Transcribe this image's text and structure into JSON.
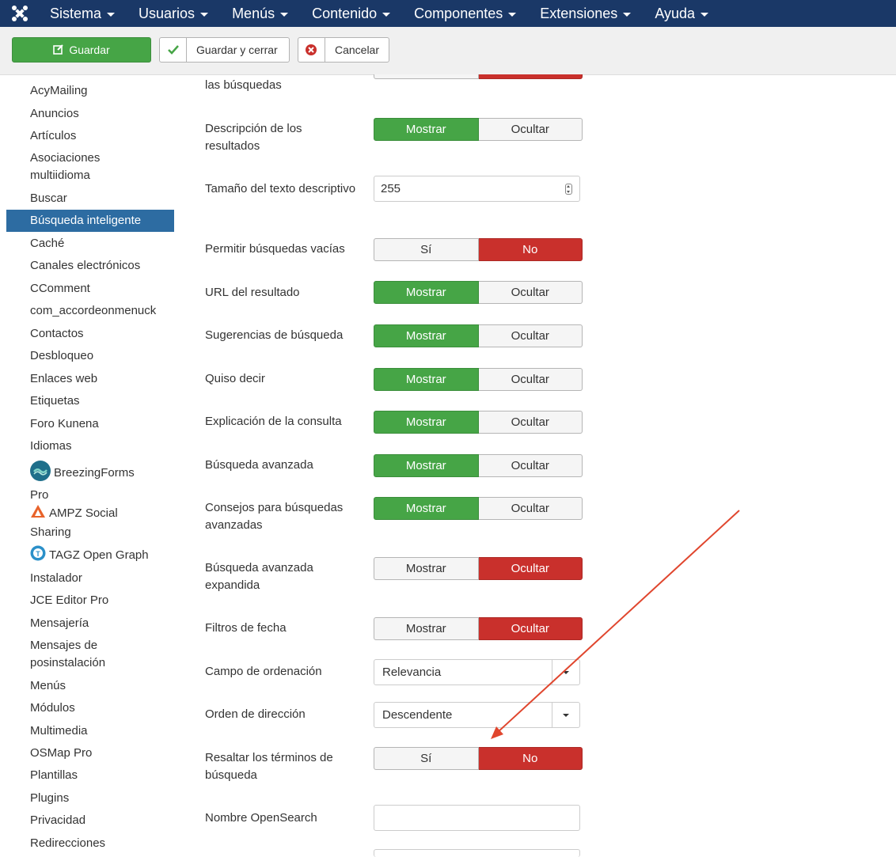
{
  "navbar": {
    "menu": [
      "Sistema",
      "Usuarios",
      "Menús",
      "Contenido",
      "Componentes",
      "Extensiones",
      "Ayuda"
    ]
  },
  "toolbar": {
    "save_label": "Guardar",
    "save_close_label": "Guardar y cerrar",
    "cancel_label": "Cancelar"
  },
  "sidebar": {
    "items": [
      {
        "label": "AcyMailing"
      },
      {
        "label": "Anuncios"
      },
      {
        "label": "Artículos"
      },
      {
        "label": "Asociaciones multiidioma"
      },
      {
        "label": "Buscar"
      },
      {
        "label": "Búsqueda inteligente",
        "active": true
      },
      {
        "label": "Caché"
      },
      {
        "label": "Canales electrónicos"
      },
      {
        "label": "CComment"
      },
      {
        "label": "com_accordeonmenuck"
      },
      {
        "label": "Contactos"
      },
      {
        "label": "Desbloqueo"
      },
      {
        "label": "Enlaces web"
      },
      {
        "label": "Etiquetas"
      },
      {
        "label": "Foro Kunena"
      },
      {
        "label": "Idiomas"
      },
      {
        "label": "BreezingForms Pro",
        "icon": "breezingforms-icon"
      },
      {
        "label": "AMPZ Social Sharing",
        "icon": "ampz-icon"
      },
      {
        "label": "TAGZ Open Graph",
        "icon": "tagz-icon"
      },
      {
        "label": "Instalador"
      },
      {
        "label": "JCE Editor Pro"
      },
      {
        "label": "Mensajería"
      },
      {
        "label": "Mensajes de posinstalación"
      },
      {
        "label": "Menús"
      },
      {
        "label": "Módulos"
      },
      {
        "label": "Multimedia"
      },
      {
        "label": "OSMap Pro"
      },
      {
        "label": "Plantillas"
      },
      {
        "label": "Plugins"
      },
      {
        "label": "Privacidad"
      },
      {
        "label": "Redirecciones"
      }
    ]
  },
  "form": {
    "rows": [
      {
        "label": "las búsquedas",
        "type": "toggle",
        "options": [
          "",
          ""
        ],
        "selected": 1,
        "partial": true
      },
      {
        "label": "Descripción de los resultados",
        "type": "toggle",
        "options": [
          "Mostrar",
          "Ocultar"
        ],
        "selected": 0
      },
      {
        "label": "Tamaño del texto descriptivo",
        "type": "number",
        "value": "255"
      },
      {
        "label": "Permitir búsquedas vacías",
        "type": "toggle",
        "options": [
          "Sí",
          "No"
        ],
        "selected": 1
      },
      {
        "label": "URL del resultado",
        "type": "toggle",
        "options": [
          "Mostrar",
          "Ocultar"
        ],
        "selected": 0
      },
      {
        "label": "Sugerencias de búsqueda",
        "type": "toggle",
        "options": [
          "Mostrar",
          "Ocultar"
        ],
        "selected": 0
      },
      {
        "label": "Quiso decir",
        "type": "toggle",
        "options": [
          "Mostrar",
          "Ocultar"
        ],
        "selected": 0
      },
      {
        "label": "Explicación de la consulta",
        "type": "toggle",
        "options": [
          "Mostrar",
          "Ocultar"
        ],
        "selected": 0
      },
      {
        "label": "Búsqueda avanzada",
        "type": "toggle",
        "options": [
          "Mostrar",
          "Ocultar"
        ],
        "selected": 0
      },
      {
        "label": "Consejos para búsquedas avanzadas",
        "type": "toggle",
        "options": [
          "Mostrar",
          "Ocultar"
        ],
        "selected": 0
      },
      {
        "label": "Búsqueda avanzada expandida",
        "type": "toggle",
        "options": [
          "Mostrar",
          "Ocultar"
        ],
        "selected": 1
      },
      {
        "label": "Filtros de fecha",
        "type": "toggle",
        "options": [
          "Mostrar",
          "Ocultar"
        ],
        "selected": 1
      },
      {
        "label": "Campo de ordenación",
        "type": "select",
        "value": "Relevancia"
      },
      {
        "label": "Orden de dirección",
        "type": "select",
        "value": "Descendente"
      },
      {
        "label": "Resaltar los términos de búsqueda",
        "type": "toggle",
        "options": [
          "Sí",
          "No"
        ],
        "selected": 1
      },
      {
        "label": "Nombre OpenSearch",
        "type": "text",
        "value": ""
      },
      {
        "label": "",
        "type": "text",
        "value": "",
        "partial": true
      }
    ]
  },
  "colors": {
    "navbar": "#1a3867",
    "green": "#46a546",
    "red": "#c9302c",
    "active": "#2d6ca2",
    "annotation_arrow": "#e0462e"
  }
}
